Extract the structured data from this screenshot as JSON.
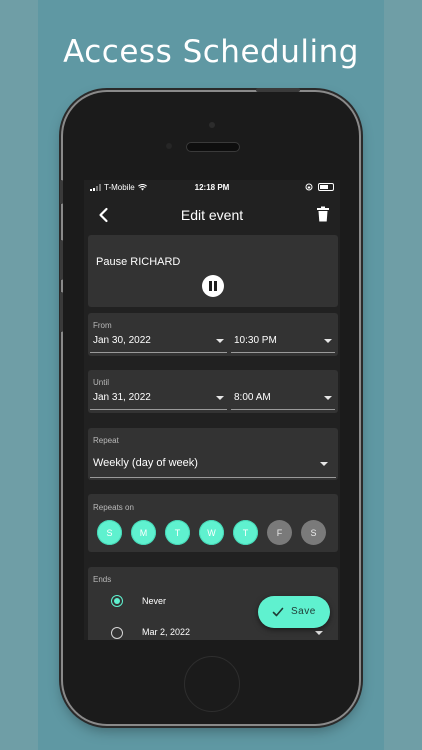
{
  "promo": {
    "title": "Access Scheduling"
  },
  "status_bar": {
    "carrier": "T-Mobile",
    "time": "12:18 PM",
    "icons": [
      "signal-icon",
      "wifi-icon",
      "orientation-lock-icon",
      "battery-icon"
    ]
  },
  "appbar": {
    "title": "Edit event",
    "back_icon": "chevron-left-icon",
    "delete_icon": "trash-icon"
  },
  "pause": {
    "label": "Pause RICHARD",
    "icon": "pause-icon"
  },
  "from": {
    "label": "From",
    "date": "Jan 30, 2022",
    "time": "10:30 PM"
  },
  "until": {
    "label": "Until",
    "date": "Jan 31, 2022",
    "time": "8:00 AM"
  },
  "repeat": {
    "label": "Repeat",
    "value": "Weekly (day of week)"
  },
  "repeats_on": {
    "label": "Repeats on",
    "days": [
      {
        "letter": "S",
        "selected": true
      },
      {
        "letter": "M",
        "selected": true
      },
      {
        "letter": "T",
        "selected": true
      },
      {
        "letter": "W",
        "selected": true
      },
      {
        "letter": "T",
        "selected": true
      },
      {
        "letter": "F",
        "selected": false
      },
      {
        "letter": "S",
        "selected": false
      }
    ]
  },
  "ends": {
    "label": "Ends",
    "options": [
      {
        "label": "Never",
        "selected": true
      },
      {
        "label": "Mar 2, 2022",
        "selected": false
      }
    ]
  },
  "save_button": {
    "label": "Save",
    "icon": "check-icon"
  },
  "colors": {
    "accent": "#5ff1cf",
    "background": "#5f98a3",
    "screen": "#212121",
    "card": "#333333",
    "day_off": "#7a7a7a"
  }
}
